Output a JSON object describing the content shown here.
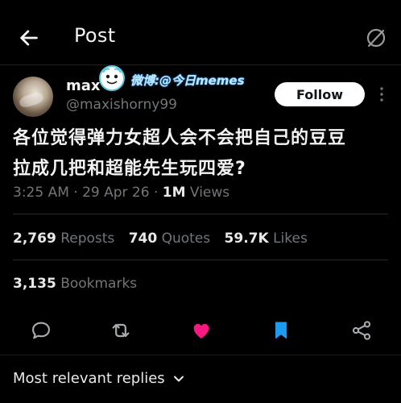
{
  "header": {
    "title": "Post",
    "back_icon": "arrow-left-icon",
    "grok_icon": "grok-icon"
  },
  "author": {
    "name": "max",
    "handle": "@maxishorny99",
    "avatar_icon": "avatar"
  },
  "watermark": {
    "text": "微博:@今日memes",
    "icon": "weibo-mascot-icon"
  },
  "follow_label": "Follow",
  "more_icon": "more-vertical-icon",
  "tweet": {
    "line1": "各位觉得弹力女超人会不会把自己的豆豆",
    "line2": "拉成几把和超能先生玩四爱?"
  },
  "meta": {
    "time_date": "3:25 AM · 29 Apr 26 · ",
    "views_count": "1M",
    "views_label": " Views"
  },
  "stats": {
    "reposts_count": "2,769",
    "reposts_label": "Reposts",
    "quotes_count": "740",
    "quotes_label": "Quotes",
    "likes_count": "59.7K",
    "likes_label": "Likes",
    "bookmarks_count": "3,135",
    "bookmarks_label": "Bookmarks"
  },
  "actions": [
    {
      "name": "reply-icon"
    },
    {
      "name": "repost-icon"
    },
    {
      "name": "like-icon",
      "color": "#f91880",
      "active": true
    },
    {
      "name": "bookmark-icon",
      "color": "#1d9bf0",
      "active": true
    },
    {
      "name": "share-icon"
    }
  ],
  "replies_sort": {
    "label": "Most relevant replies"
  },
  "colors": {
    "like": "#f91880",
    "bookmark": "#1d9bf0",
    "muted": "#71767b"
  }
}
